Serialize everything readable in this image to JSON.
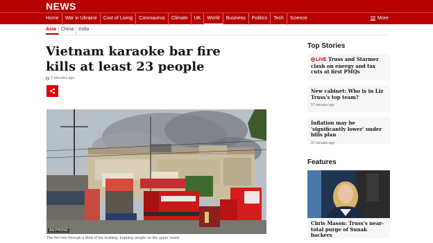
{
  "brand": {
    "name": "NEWS"
  },
  "nav": {
    "items": [
      "Home",
      "War in Ukraine",
      "Cost of Living",
      "Coronavirus",
      "Climate",
      "UK",
      "World",
      "Business",
      "Politics",
      "Tech",
      "Science"
    ],
    "active": "World",
    "more_label": "More"
  },
  "subnav": {
    "items": [
      "Asia",
      "China",
      "India"
    ],
    "active": "Asia"
  },
  "article": {
    "headline": "Vietnam karaoke bar fire kills at least 23 people",
    "timestamp": "2 minutes ago",
    "image_credit": "AN PHONG",
    "caption": "The fire tore through a third of the building, trapping people on the upper levels"
  },
  "sidebar": {
    "top_stories_title": "Top Stories",
    "stories": [
      {
        "live": "LIVE",
        "title": "Truss and Starmer clash on energy and tax cuts at first PMQs",
        "time": ""
      },
      {
        "live": "",
        "title": "New cabinet: Who is in Liz Truss's top team?",
        "time": "57 minutes ago"
      },
      {
        "live": "",
        "title": "Inflation may be 'significantly lower' under bills plan",
        "time": "37 minutes ago"
      }
    ],
    "features_title": "Features",
    "feature": {
      "title": "Chris Mason: Truss's near-total purge of Sunak backers"
    }
  },
  "colors": {
    "brand_red": "#b80000",
    "share_red": "#e00000",
    "card_bg": "#f6f6f6"
  },
  "icons": [
    "menu-icon",
    "clock-icon",
    "share-icon",
    "live-icon"
  ]
}
